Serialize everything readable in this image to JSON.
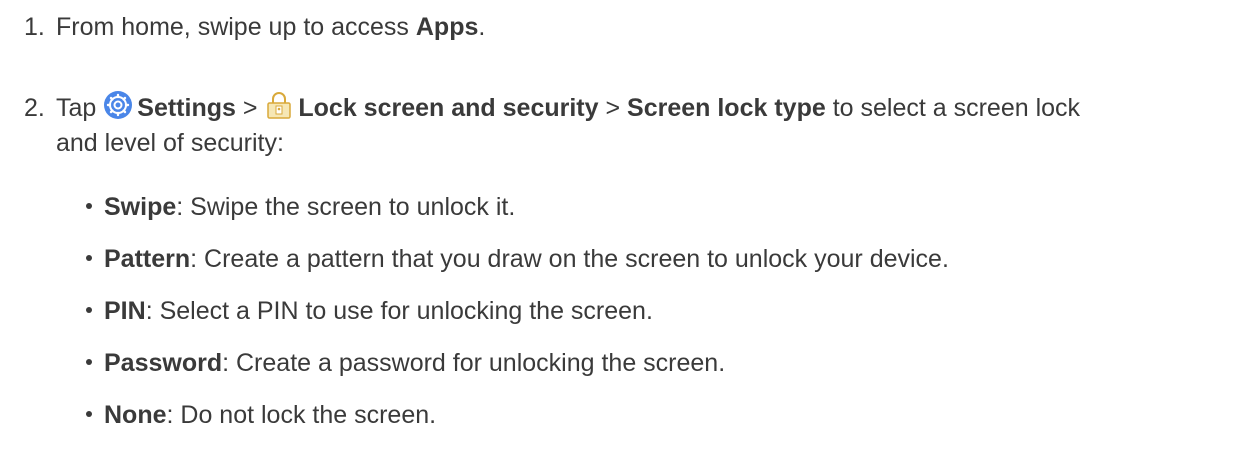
{
  "steps": [
    {
      "number": "1.",
      "prefix": "From home, swipe up to access ",
      "bold": "Apps",
      "suffix": "."
    },
    {
      "number": "2.",
      "tap": "Tap ",
      "settings_icon": "settings-gear-icon",
      "settings_label": "Settings",
      "sep1": " > ",
      "lock_icon": "padlock-icon",
      "lock_label": "Lock screen and security",
      "sep2": " > ",
      "type_label": "Screen lock type",
      "text_after": " to select a screen lock",
      "text_line2": "and level of security:"
    }
  ],
  "bullets": [
    {
      "term": "Swipe",
      "desc": ": Swipe the screen to unlock it."
    },
    {
      "term": "Pattern",
      "desc": ": Create a pattern that you draw on the screen to unlock your device."
    },
    {
      "term": "PIN",
      "desc": ": Select a PIN to use for unlocking the screen."
    },
    {
      "term": "Password",
      "desc": ": Create a password for unlocking the screen."
    },
    {
      "term": "None",
      "desc": ": Do not lock the screen."
    }
  ],
  "colors": {
    "text": "#3a3a3a",
    "settings_icon_bg": "#4a86e8",
    "lock_icon_body": "#f6e7b5",
    "lock_icon_outline": "#d9a93a"
  }
}
